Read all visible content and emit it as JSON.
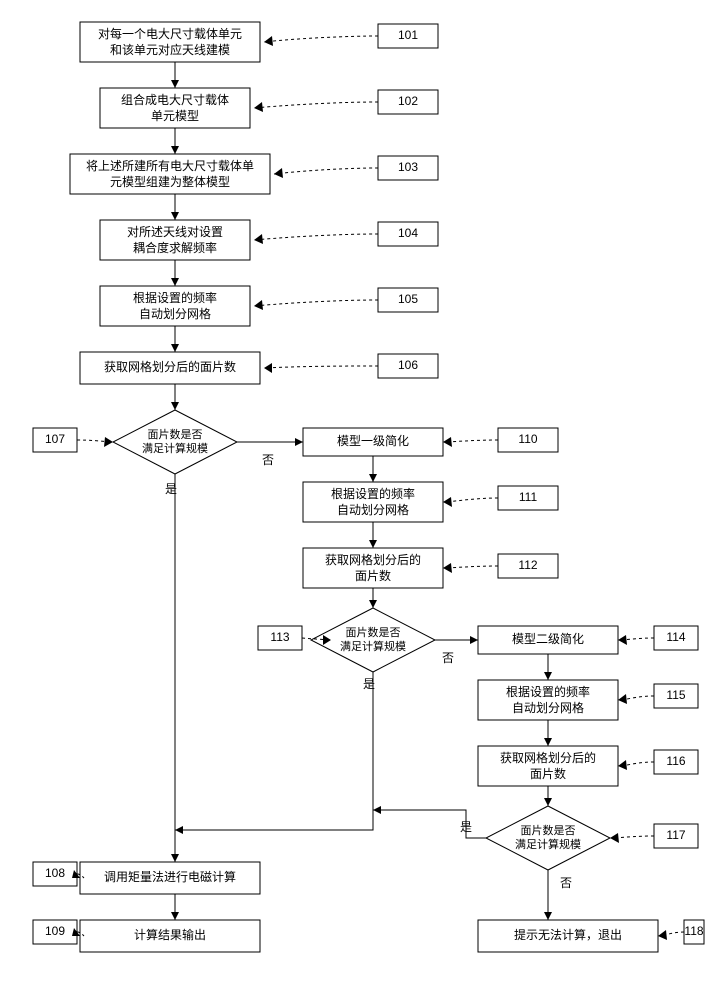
{
  "steps": {
    "s101": [
      "对每一个电大尺寸载体单元",
      "和该单元对应天线建模"
    ],
    "s102": [
      "组合成电大尺寸载体",
      "单元模型"
    ],
    "s103": [
      "将上述所建所有电大尺寸载体单",
      "元模型组建为整体模型"
    ],
    "s104": [
      "对所述天线对设置",
      "耦合度求解频率"
    ],
    "s105": [
      "根据设置的频率",
      "自动划分网格"
    ],
    "s106": [
      "获取网格划分后的面片数"
    ],
    "d107": [
      "面片数是否",
      "满足计算规模"
    ],
    "s108": [
      "调用矩量法进行电磁计算"
    ],
    "s109": [
      "计算结果输出"
    ],
    "s110": [
      "模型一级简化"
    ],
    "s111": [
      "根据设置的频率",
      "自动划分网格"
    ],
    "s112": [
      "获取网格划分后的",
      "面片数"
    ],
    "d113": [
      "面片数是否",
      "满足计算规模"
    ],
    "s114": [
      "模型二级简化"
    ],
    "s115": [
      "根据设置的频率",
      "自动划分网格"
    ],
    "s116": [
      "获取网格划分后的",
      "面片数"
    ],
    "d117": [
      "面片数是否",
      "满足计算规模"
    ],
    "s118": [
      "提示无法计算，退出"
    ]
  },
  "labels": {
    "l101": "101",
    "l102": "102",
    "l103": "103",
    "l104": "104",
    "l105": "105",
    "l106": "106",
    "l107": "107",
    "l108": "108",
    "l109": "109",
    "l110": "110",
    "l111": "111",
    "l112": "112",
    "l113": "113",
    "l114": "114",
    "l115": "115",
    "l116": "116",
    "l117": "117",
    "l118": "118"
  },
  "branch": {
    "yes": "是",
    "no": "否"
  }
}
